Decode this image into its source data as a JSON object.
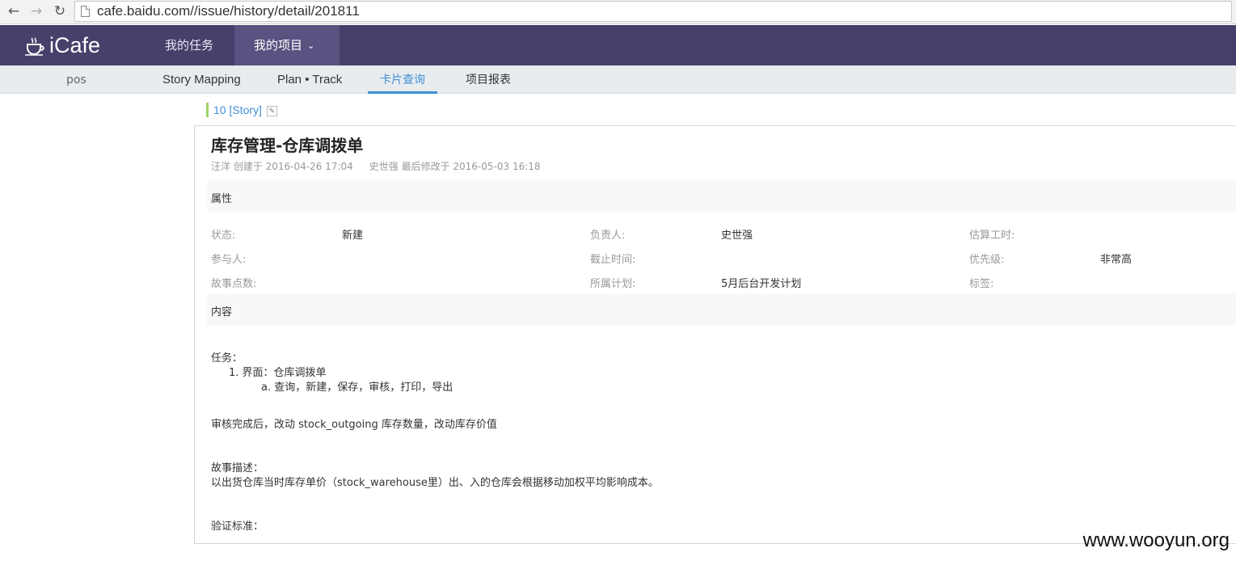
{
  "browser": {
    "url": "cafe.baidu.com//issue/history/detail/201811"
  },
  "app": {
    "logo_text": "iCafe",
    "nav": {
      "tasks": "我的任务",
      "projects": "我的项目"
    }
  },
  "subnav": {
    "project": "pos",
    "story_mapping": "Story Mapping",
    "plan_track": "Plan • Track",
    "card_query": "卡片查询",
    "report": "项目报表"
  },
  "card": {
    "id_label": "10 [Story]",
    "title": "库存管理-仓库调拨单",
    "created": "汪洋 创建于 2016-04-26 17:04",
    "modified": "史世强 最后修改于 2016-05-03 16:18",
    "attributes_header": "属性",
    "content_header": "内容",
    "attributes": {
      "status_label": "状态:",
      "status_value": "新建",
      "owner_label": "负责人:",
      "owner_value": "史世强",
      "estimate_label": "估算工时:",
      "participants_label": "参与人:",
      "deadline_label": "截止时间:",
      "priority_label": "优先级:",
      "priority_value": "非常高",
      "points_label": "故事点数:",
      "plan_label": "所属计划:",
      "plan_value": "5月后台开发计划",
      "tags_label": "标签:"
    },
    "content": {
      "tasks_label": "任务：",
      "item_1": "1.  界面：仓库调拨单",
      "item_1a": "a.  查询，新建，保存，审核，打印，导出",
      "audit_note": "审核完成后，改动  stock_outgoing 库存数量，改动库存价值",
      "story_desc_label": "故事描述：",
      "story_desc": "以出货仓库当时库存单价（stock_warehouse里）出、入的仓库会根据移动加权平均影响成本。",
      "verify_label": "验证标准："
    }
  },
  "watermark": "www.wooyun.org"
}
